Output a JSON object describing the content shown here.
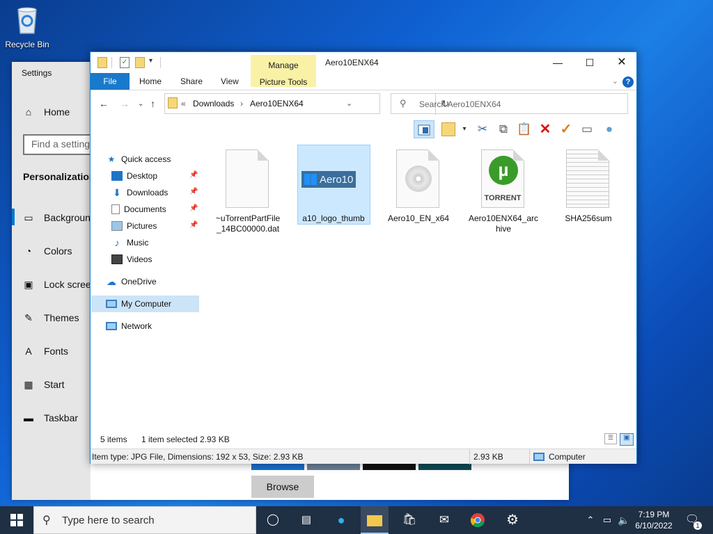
{
  "desktop": {
    "recycle_bin_label": "Recycle Bin"
  },
  "settings": {
    "title": "Settings",
    "home": "Home",
    "find_placeholder": "Find a setting",
    "section": "Personalization",
    "nav": [
      "Background",
      "Colors",
      "Lock screen",
      "Themes",
      "Fonts",
      "Start",
      "Taskbar"
    ],
    "browse": "Browse"
  },
  "explorer": {
    "title": "Aero10ENX64",
    "manage": "Manage",
    "picture_tools": "Picture Tools",
    "tabs": {
      "file": "File",
      "home": "Home",
      "share": "Share",
      "view": "View"
    },
    "path": {
      "prefix": "«",
      "downloads": "Downloads",
      "folder": "Aero10ENX64"
    },
    "search_placeholder": "Search Aero10ENX64",
    "tree": {
      "quick_access": "Quick access",
      "desktop": "Desktop",
      "downloads": "Downloads",
      "documents": "Documents",
      "pictures": "Pictures",
      "music": "Music",
      "videos": "Videos",
      "onedrive": "OneDrive",
      "my_computer": "My Computer",
      "network": "Network"
    },
    "files": [
      {
        "name1": "~uTorrentPartFile",
        "name2": "_14BC00000.dat"
      },
      {
        "name1": "a10_logo_thumb",
        "name2": "",
        "logo_text": "Aero10"
      },
      {
        "name1": "Aero10_EN_x64",
        "name2": ""
      },
      {
        "name1": "Aero10ENX64_arc",
        "name2": "hive",
        "badge": "TORRENT"
      },
      {
        "name1": "SHA256sum",
        "name2": ""
      }
    ],
    "status": {
      "items": "5 items",
      "selected": "1 item selected",
      "size": "2.93 KB"
    },
    "details": {
      "info": "Item type: JPG File, Dimensions: 192 x 53, Size: 2.93 KB",
      "size": "2.93 KB",
      "location": "Computer"
    }
  },
  "taskbar": {
    "search_placeholder": "Type here to search",
    "time": "7:19 PM",
    "date": "6/10/2022",
    "notif_count": "1"
  }
}
